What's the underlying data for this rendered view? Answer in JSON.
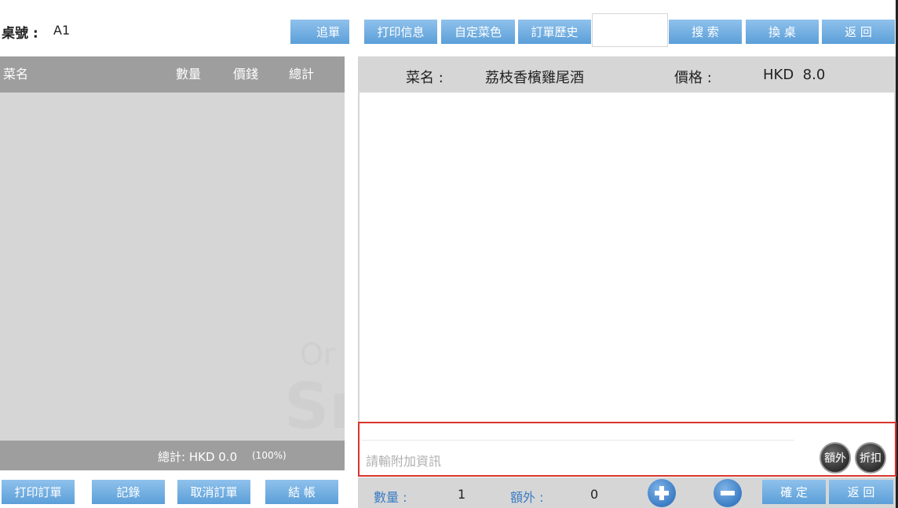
{
  "header": {
    "table_label": "桌號 :",
    "table_value": "A1",
    "search_value": "",
    "buttons": {
      "add_order": "追單",
      "print_info": "打印信息",
      "custom_dish": "自定菜色",
      "order_history": "訂單歷史",
      "search": "搜 索",
      "change_table": "換 桌",
      "back": "返 回"
    }
  },
  "order_list": {
    "columns": [
      "菜名",
      "數量",
      "價錢",
      "總計"
    ],
    "rows": [],
    "total_text": "總計: HKD 0.0",
    "total_percent": "(100%)"
  },
  "dish": {
    "name_label": "菜名 :",
    "name_value": "荔枝香檳雞尾酒",
    "price_label": "價格 :",
    "price_value": "HKD  8.0"
  },
  "note": {
    "placeholder": "請輸附加資訊",
    "extra_button": "額外",
    "discount_button": "折扣"
  },
  "quantity": {
    "label": "數量 :",
    "value": "1",
    "extra_label": "額外 :",
    "extra_value": "0"
  },
  "bottom_left_buttons": {
    "print_order": "打印訂單",
    "records": "記錄",
    "cancel_order": "取消訂單",
    "checkout": "結 帳"
  },
  "bottom_right_buttons": {
    "confirm": "確 定",
    "back": "返 回"
  },
  "icons": {
    "plus": "plus-icon",
    "minus": "minus-icon"
  },
  "colors": {
    "button": "#5b9fd8",
    "panel_gray": "#d6d6d6",
    "header_gray": "#9e9e9e",
    "highlight_border": "#d9342b"
  }
}
